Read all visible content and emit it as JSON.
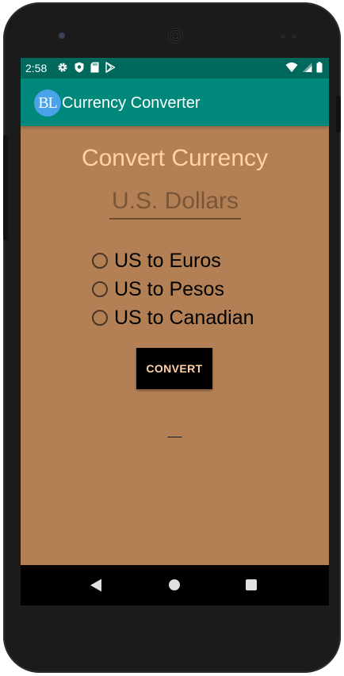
{
  "status_bar": {
    "time": "2:58",
    "left_icons": [
      "gear-icon",
      "shield-icon",
      "sd-card-icon",
      "play-store-icon"
    ],
    "right_icons": [
      "wifi-icon",
      "cell-signal-icon",
      "battery-icon"
    ]
  },
  "app_bar": {
    "logo_text": "BL",
    "title": "Currency Converter"
  },
  "main": {
    "heading": "Convert Currency",
    "amount_input": {
      "value": "",
      "placeholder": "U.S. Dollars"
    },
    "conversion_options": [
      {
        "label": "US to Euros",
        "selected": false
      },
      {
        "label": "US to Pesos",
        "selected": false
      },
      {
        "label": "US to Canadian",
        "selected": false
      }
    ],
    "convert_button_label": "CONVERT",
    "result_text": "__"
  },
  "nav_bar": {
    "icons": [
      "back-icon",
      "home-icon",
      "recents-icon"
    ]
  },
  "colors": {
    "status_bar": "#00695c",
    "app_bar": "#00897b",
    "background": "#b38055",
    "heading_text": "#ffd3a6",
    "button_background": "#000000",
    "logo_background": "#4aa3e8"
  }
}
